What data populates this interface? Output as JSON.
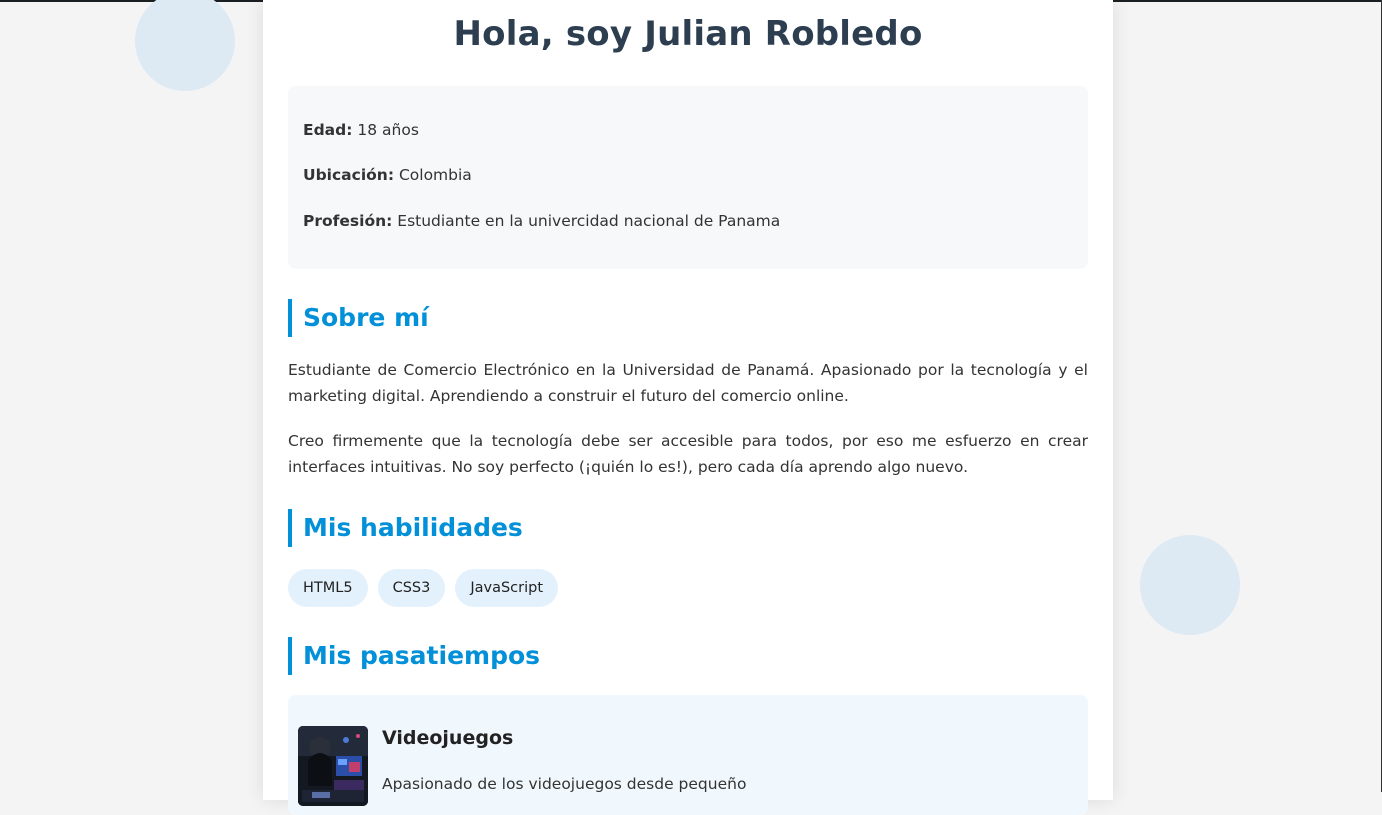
{
  "header": {
    "title": "Hola, soy Julian Robledo"
  },
  "info": {
    "age_label": "Edad:",
    "age_value": " 18 años",
    "location_label": "Ubicación:",
    "location_value": " Colombia",
    "profession_label": "Profesión:",
    "profession_value": " Estudiante en la univercidad nacional de Panama"
  },
  "about": {
    "heading": "Sobre mí",
    "paragraphs": [
      "Estudiante de Comercio Electrónico en la Universidad de Panamá. Apasionado por la tecnología y el marketing digital. Aprendiendo a construir el futuro del comercio online.",
      "Creo firmemente que la tecnología debe ser accesible para todos, por eso me esfuerzo en crear interfaces intuitivas. No soy perfecto (¡quién lo es!), pero cada día aprendo algo nuevo."
    ]
  },
  "skills": {
    "heading": "Mis habilidades",
    "items": [
      "HTML5",
      "CSS3",
      "JavaScript"
    ]
  },
  "hobbies": {
    "heading": "Mis pasatiempos",
    "items": [
      {
        "title": "Videojuegos",
        "description": "Apasionado de los videojuegos desde pequeño",
        "icon": "gaming-photo"
      }
    ]
  },
  "colors": {
    "accent": "#0290d8",
    "title": "#2c3e50",
    "chip_bg": "#e3f1fc",
    "bubble": "#dde9f3",
    "page_bg": "#f4f4f4"
  }
}
